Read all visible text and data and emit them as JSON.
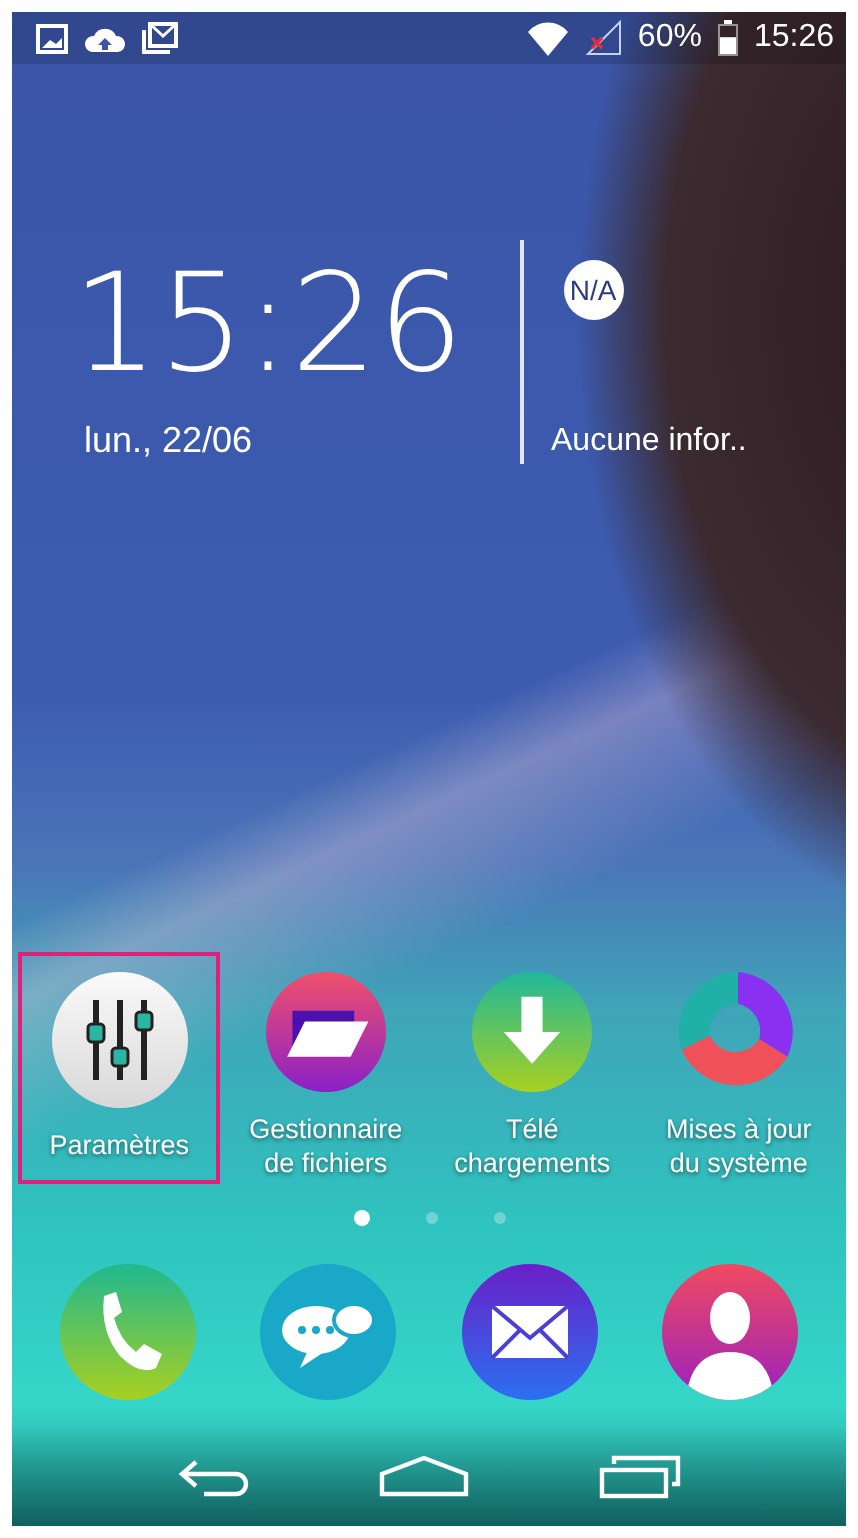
{
  "status_bar": {
    "battery_text": "60%",
    "time": "15:26"
  },
  "clock": {
    "time": "15:26",
    "date": "lun., 22/06"
  },
  "weather": {
    "badge": "N/A",
    "text": "Aucune infor.."
  },
  "apps": [
    {
      "kind": "settings",
      "label": "Paramètres",
      "selected": true
    },
    {
      "kind": "files",
      "label": "Gestionnaire de fichiers",
      "selected": false
    },
    {
      "kind": "downloads",
      "label": "Télé chargements",
      "selected": false
    },
    {
      "kind": "updates",
      "label": "Mises à jour du système",
      "selected": false
    }
  ],
  "page_dots": [
    {
      "selected": true
    },
    {
      "selected": false
    },
    {
      "selected": false
    }
  ],
  "dock": [
    {
      "kind": "phone"
    },
    {
      "kind": "messages"
    },
    {
      "kind": "mail"
    },
    {
      "kind": "contacts"
    }
  ],
  "nav": [
    {
      "kind": "back"
    },
    {
      "kind": "home"
    },
    {
      "kind": "recent"
    }
  ]
}
